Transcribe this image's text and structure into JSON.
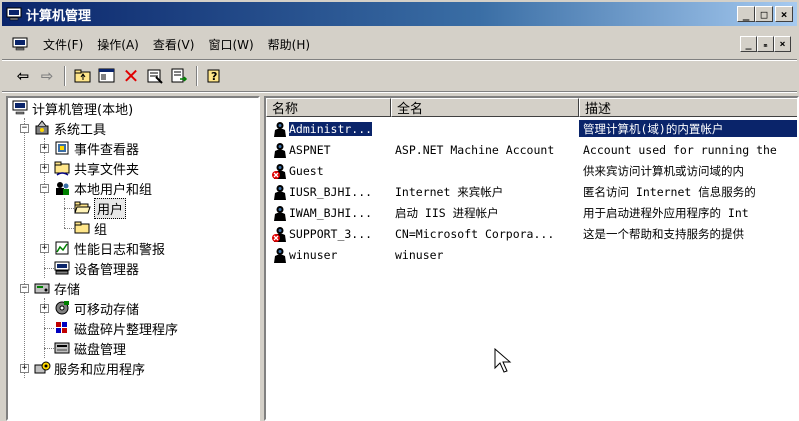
{
  "window": {
    "title": "计算机管理",
    "caption_buttons": [
      "_",
      "□",
      "×"
    ],
    "mdi_buttons": [
      "_",
      "ₘ",
      "×"
    ]
  },
  "menu": {
    "items": [
      "文件(F)",
      "操作(A)",
      "查看(V)",
      "窗口(W)",
      "帮助(H)"
    ]
  },
  "toolbar": {
    "buttons": [
      "back-icon",
      "forward-icon",
      "up-folder-icon",
      "show-tree-icon",
      "delete-icon",
      "properties-icon",
      "export-icon",
      "help-icon"
    ]
  },
  "tree": {
    "nodes": [
      {
        "label": "计算机管理(本地)",
        "icon": "computer-icon"
      },
      {
        "label": "系统工具",
        "icon": "tools-icon"
      },
      {
        "label": "事件查看器",
        "icon": "event-viewer-icon"
      },
      {
        "label": "共享文件夹",
        "icon": "shared-folder-icon"
      },
      {
        "label": "本地用户和组",
        "icon": "users-groups-icon"
      },
      {
        "label": "用户",
        "icon": "folder-icon"
      },
      {
        "label": "组",
        "icon": "folder-icon"
      },
      {
        "label": "性能日志和警报",
        "icon": "performance-icon"
      },
      {
        "label": "设备管理器",
        "icon": "device-manager-icon"
      },
      {
        "label": "存储",
        "icon": "storage-icon"
      },
      {
        "label": "可移动存储",
        "icon": "removable-storage-icon"
      },
      {
        "label": "磁盘碎片整理程序",
        "icon": "defrag-icon"
      },
      {
        "label": "磁盘管理",
        "icon": "disk-management-icon"
      },
      {
        "label": "服务和应用程序",
        "icon": "services-icon"
      }
    ]
  },
  "list": {
    "headers": [
      "名称",
      "全名",
      "描述"
    ],
    "rows": [
      {
        "name": "Administr...",
        "full": "",
        "desc": "管理计算机(域)的内置帐户",
        "disabled": false
      },
      {
        "name": "ASPNET",
        "full": "ASP.NET Machine Account",
        "desc": "Account used for running the",
        "disabled": false
      },
      {
        "name": "Guest",
        "full": "",
        "desc": "供来宾访问计算机或访问域的内",
        "disabled": true
      },
      {
        "name": "IUSR_BJHI...",
        "full": "Internet 来宾帐户",
        "desc": "匿名访问 Internet 信息服务的",
        "disabled": false
      },
      {
        "name": "IWAM_BJHI...",
        "full": "启动 IIS 进程帐户",
        "desc": "用于启动进程外应用程序的 Int",
        "disabled": false
      },
      {
        "name": "SUPPORT_3...",
        "full": "CN=Microsoft Corpora...",
        "desc": "这是一个帮助和支持服务的提供",
        "disabled": true
      },
      {
        "name": "winuser",
        "full": "winuser",
        "desc": "",
        "disabled": false
      }
    ]
  },
  "colors": {
    "titlebar_start": "#0a246a",
    "titlebar_end": "#a6caf0",
    "selection": "#0a246a",
    "face": "#d4d0c8"
  }
}
